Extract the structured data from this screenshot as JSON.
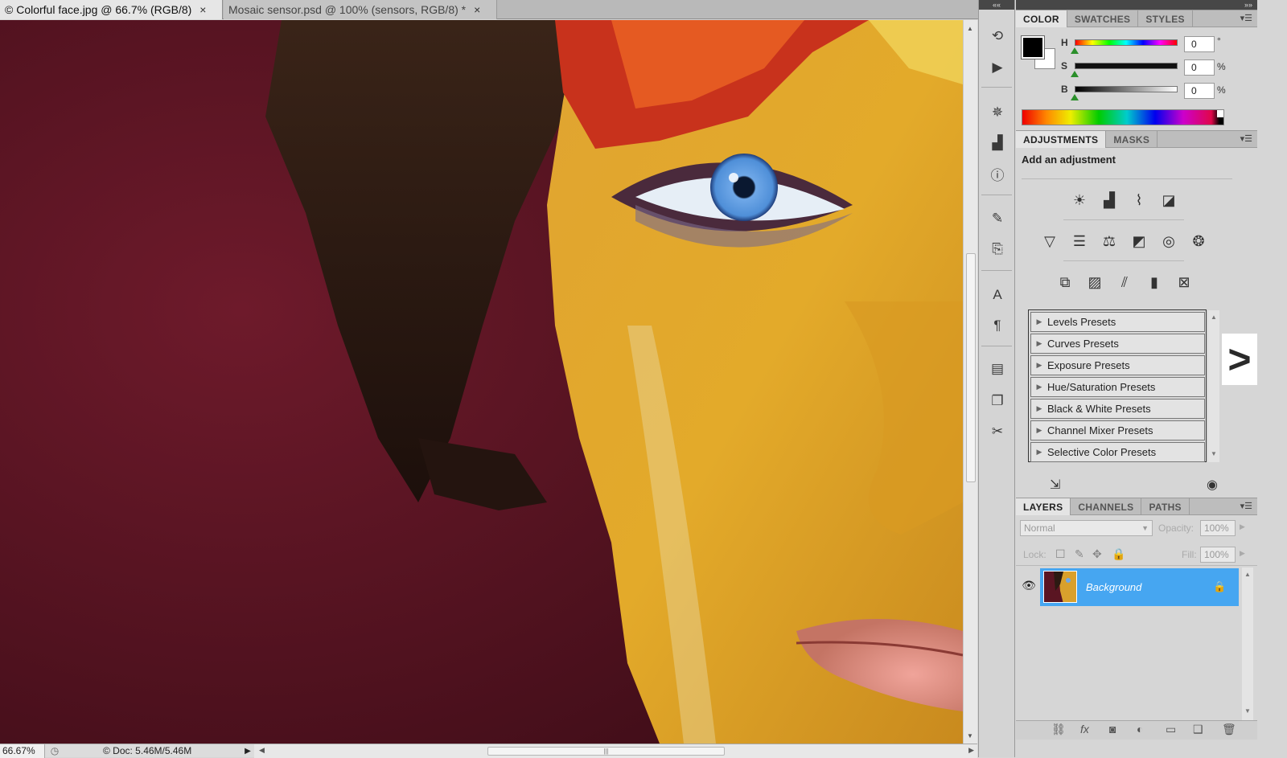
{
  "document_tabs": [
    {
      "label": "© Colorful face.jpg @ 66.7% (RGB/8)",
      "close": "×"
    },
    {
      "label": "Mosaic sensor.psd @ 100% (sensors, RGB/8) *",
      "close": "×"
    }
  ],
  "status": {
    "zoom": "66.67%",
    "doc_info": "© Doc: 5.46M/5.46M",
    "menu_arrow": "▶"
  },
  "panel_strip": {
    "collapse": "««",
    "dock_collapse": "»»"
  },
  "color_panel": {
    "tabs": [
      "COLOR",
      "SWATCHES",
      "STYLES"
    ],
    "sliders": [
      {
        "label": "H",
        "value": "0",
        "unit": "°"
      },
      {
        "label": "S",
        "value": "0",
        "unit": "%"
      },
      {
        "label": "B",
        "value": "0",
        "unit": "%"
      }
    ],
    "foreground": "#000000",
    "background": "#ffffff"
  },
  "adjustments_panel": {
    "tabs": [
      "ADJUSTMENTS",
      "MASKS"
    ],
    "title": "Add an adjustment",
    "presets": [
      "Levels Presets",
      "Curves Presets",
      "Exposure Presets",
      "Hue/Saturation Presets",
      "Black & White Presets",
      "Channel Mixer Presets",
      "Selective Color Presets"
    ]
  },
  "layers_panel": {
    "tabs": [
      "LAYERS",
      "CHANNELS",
      "PATHS"
    ],
    "blend_mode": "Normal",
    "opacity_label": "Opacity:",
    "opacity_value": "100%",
    "lock_label": "Lock:",
    "fill_label": "Fill:",
    "fill_value": "100%",
    "layer_name": "Background"
  },
  "colors": {
    "selection": "#46a6f1",
    "canvas_bg": "#5a1522"
  }
}
